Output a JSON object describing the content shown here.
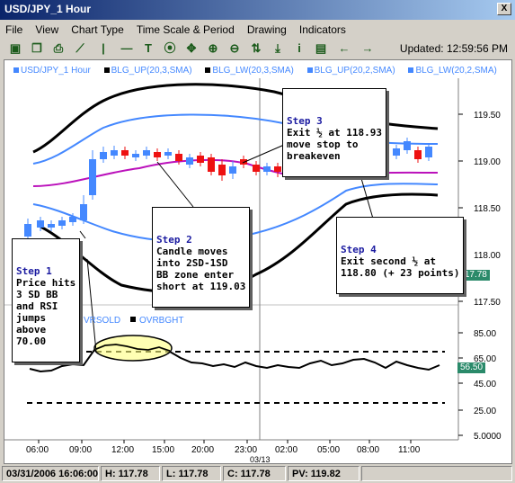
{
  "window": {
    "title": "USD/JPY_1 Hour",
    "close_glyph": "X"
  },
  "menu": [
    "File",
    "View",
    "Chart Type",
    "Time Scale & Period",
    "Drawing",
    "Indicators"
  ],
  "toolbar": {
    "icons": [
      "save-icon",
      "copy-icon",
      "print-icon",
      "line-draw-icon",
      "vertical-line-icon",
      "horizontal-line-icon",
      "text-icon",
      "record-icon",
      "move-icon",
      "zoom-in-icon",
      "zoom-out-icon",
      "fit-icon",
      "download-icon",
      "info-icon",
      "chart-icon",
      "arrow-left-icon",
      "arrow-right-icon"
    ],
    "updated_label": "Updated: 12:59:56 PM"
  },
  "legend": [
    {
      "label": "USD/JPY_1 Hour",
      "color": "#4488ff"
    },
    {
      "label": "BLG_UP(20,3,SMA)",
      "color": "#000000"
    },
    {
      "label": "BLG_LW(20,3,SMA)",
      "color": "#000000"
    },
    {
      "label": "BLG_UP(20,2,SMA)",
      "color": "#4488ff"
    },
    {
      "label": "BLG_LW(20,2,SMA)",
      "color": "#4488ff"
    }
  ],
  "rsi_legend": [
    "VRSOLD",
    "OVRBGHT"
  ],
  "price_axis": [
    "119.50",
    "119.00",
    "118.50",
    "118.00",
    "117.50"
  ],
  "rsi_axis": [
    "85.00",
    "65.00",
    "45.00",
    "25.00",
    "5.0000"
  ],
  "price_tag": "117.78",
  "rsi_tag": "56.50",
  "time_axis": [
    "06:00",
    "09:00",
    "12:00",
    "15:00",
    "20:00",
    "23:00",
    "02:00",
    "05:00",
    "08:00",
    "11:00"
  ],
  "date_label": "03/13",
  "callouts": {
    "step1": {
      "title": "Step 1",
      "body": "Price hits\n3 SD BB\nand RSI\njumps\nabove\n70.00"
    },
    "step2": {
      "title": "Step 2",
      "body": "Candle moves\ninto 2SD-1SD\nBB zone enter\nshort at 119.03"
    },
    "step3": {
      "title": "Step 3",
      "body": "Exit ½ at 118.93\nmove stop to\nbreakeven"
    },
    "step4": {
      "title": "Step 4",
      "body": "Exit second ½ at\n118.80 (+ 23 points)"
    }
  },
  "status": {
    "datetime": "03/31/2006 16:06:00",
    "high": "H: 117.78",
    "low": "L: 117.78",
    "close": "C: 117.78",
    "pv": "PV: 119.82"
  },
  "colors": {
    "accent": "#0a246a",
    "up": "#4488ff",
    "down": "#ee1111",
    "mid": "#bb11bb",
    "tag": "#2a8a6a"
  }
}
